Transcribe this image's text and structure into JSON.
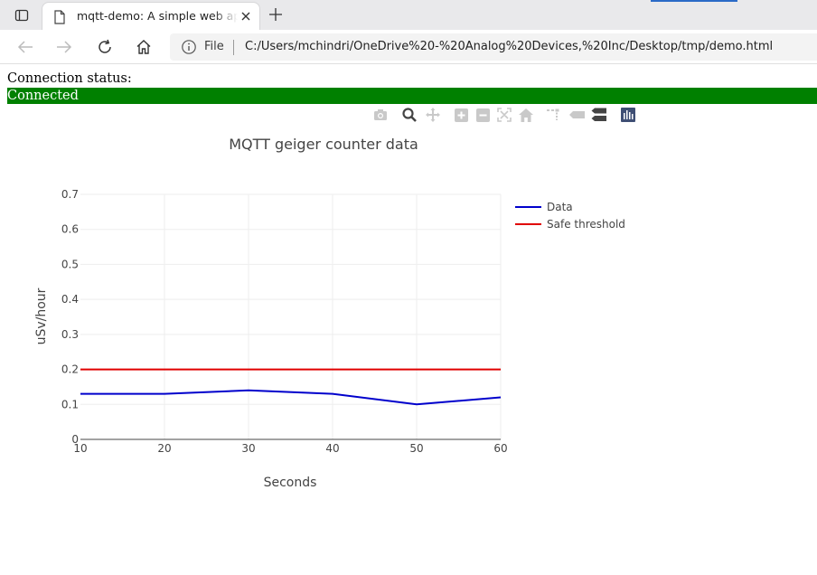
{
  "browser": {
    "tab_title": "mqtt-demo: A simple web application",
    "address_scheme_label": "File",
    "address_url": "C:/Users/mchindri/OneDrive%20-%20Analog%20Devices,%20Inc/Desktop/tmp/demo.html",
    "icons": [
      "tab-panel-icon",
      "file-icon",
      "close-icon",
      "plus-icon",
      "back-arrow-icon",
      "forward-arrow-icon",
      "refresh-icon",
      "home-icon",
      "info-icon"
    ]
  },
  "page": {
    "status_label": "Connection status:",
    "status_value": "Connected",
    "status_color": "#008000"
  },
  "modebar": {
    "icons": [
      "camera-icon",
      "zoom-icon",
      "pan-icon",
      "zoom-in-icon",
      "zoom-out-icon",
      "autoscale-icon",
      "reset-axes-icon",
      "spike-lines-icon",
      "hover-closest-icon",
      "hover-compare-icon",
      "plotly-logo-icon"
    ]
  },
  "chart_data": {
    "type": "line",
    "title": "MQTT geiger counter data",
    "xlabel": "Seconds",
    "ylabel": "uSv/hour",
    "xlim": [
      10,
      60
    ],
    "ylim": [
      0,
      0.7
    ],
    "xticks": [
      "10",
      "20",
      "30",
      "40",
      "50",
      "60"
    ],
    "yticks": [
      "0",
      "0.1",
      "0.2",
      "0.3",
      "0.4",
      "0.5",
      "0.6",
      "0.7"
    ],
    "grid": true,
    "legend_position": "top-right",
    "series": [
      {
        "name": "Data",
        "color": "#0000cc",
        "x": [
          10,
          20,
          30,
          40,
          50,
          60
        ],
        "y": [
          0.13,
          0.13,
          0.14,
          0.13,
          0.1,
          0.12
        ]
      },
      {
        "name": "Safe threshold",
        "color": "#e00000",
        "x": [
          10,
          20,
          30,
          40,
          50,
          60
        ],
        "y": [
          0.2,
          0.2,
          0.2,
          0.2,
          0.2,
          0.2
        ]
      }
    ]
  }
}
